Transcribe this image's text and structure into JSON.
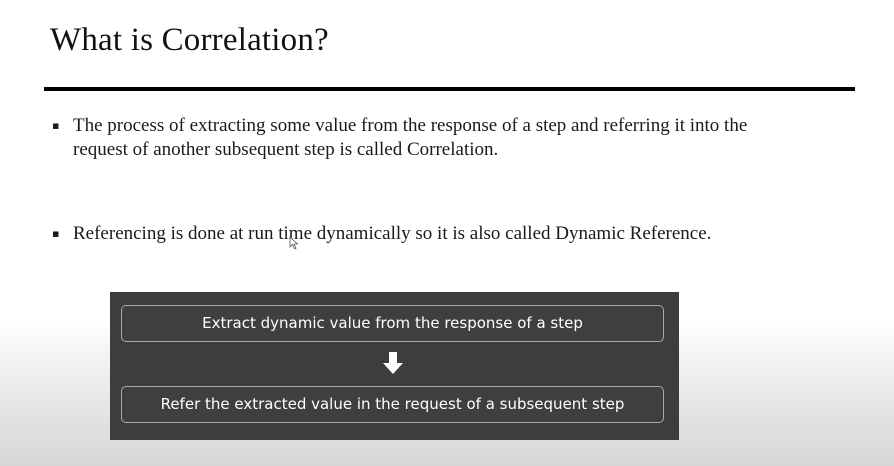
{
  "slide": {
    "title": "What is Correlation?",
    "bullets": [
      {
        "line1": "The process of extracting some value from the response of a step and referring it into the",
        "line2": "request of another subsequent step is called Correlation."
      },
      {
        "line1": "Referencing is done at run time dynamically so it is also called Dynamic Reference."
      }
    ],
    "bullet_marker": "▪"
  },
  "diagram": {
    "steps": [
      "Extract dynamic value from the response of a step",
      "Refer the extracted value in the request of a subsequent step"
    ],
    "arrow_icon": "down-arrow-icon"
  },
  "colors": {
    "diagram_background": "#3d3d3d",
    "box_border": "#a8a8a8",
    "box_text": "#ffffff",
    "title_rule": "#000000"
  }
}
